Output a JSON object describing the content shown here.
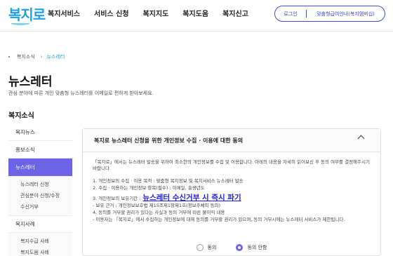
{
  "header": {
    "logo": "복지로",
    "nav": [
      "복지서비스",
      "서비스 신청",
      "복지지도",
      "복지도움",
      "복지신고"
    ],
    "login_label": "로그인",
    "mypage_label": "맞춤형급여안내(복지멤버십)"
  },
  "breadcrumb": {
    "parent": "복지소식",
    "current": "뉴스레터"
  },
  "page": {
    "title": "뉴스레터",
    "description": "관심 분야에 따른 개인 맞춤형 뉴스레터를 이메일로 편하게 받아보세요."
  },
  "sidebar": {
    "title": "복지소식",
    "items": [
      "복지뉴스",
      "홍보소식",
      "뉴스레터"
    ],
    "sub_items": [
      "뉴스레터 신청",
      "관심분야 신청/수정",
      "수신거부"
    ],
    "group2": "복지사례",
    "group2_sub": [
      "복지수급 사례",
      "복지도움 사례"
    ]
  },
  "panel": {
    "title": "복지로 뉴스레터 신청을 위한 개인정보 수집 · 이용에 대한 동의",
    "intro": "「복지로」에서는 뉴스레터 발송을 위하여 최소한의 개인정보를 수집 및 이용합니다. 아래의 내용을 자세히 읽어보신 후 동의 여부를 결정해주시기 바랍니다.",
    "line1": "1. 개인정보의 수집 · 이용 목적 : 맞춤형 복지정보 및 복지서비스 뉴스레터 발송",
    "line2": "2. 수집 · 이용하는 개인정보 항목(필수) : 이메일, 출생년도",
    "line3": "3. 개인정보의 보유기간 :",
    "link": "뉴스레터 수신거부 시 즉시 파기",
    "line3b": "- 보유 근거 : 개인정보보호법 제15조제1항제1호(정보주체의 동의)",
    "line4": "4. 동의를 거부할 권리가 있다는 사실과 동의 거부에 따른 불이익 내용",
    "line4b": "- 이용자는 「복지로」에서 수집하는 개인정보에 대해 동의를 거부할 권리가 있으며, 동의 거부시에는 뉴스레터 서비스가 제한됩니다.",
    "agree": "동의",
    "agree_checked": "동의 안함"
  },
  "colors": {
    "accent": "#6c63e6",
    "brand": "#1ea0e6",
    "link": "#1a1ae0"
  }
}
